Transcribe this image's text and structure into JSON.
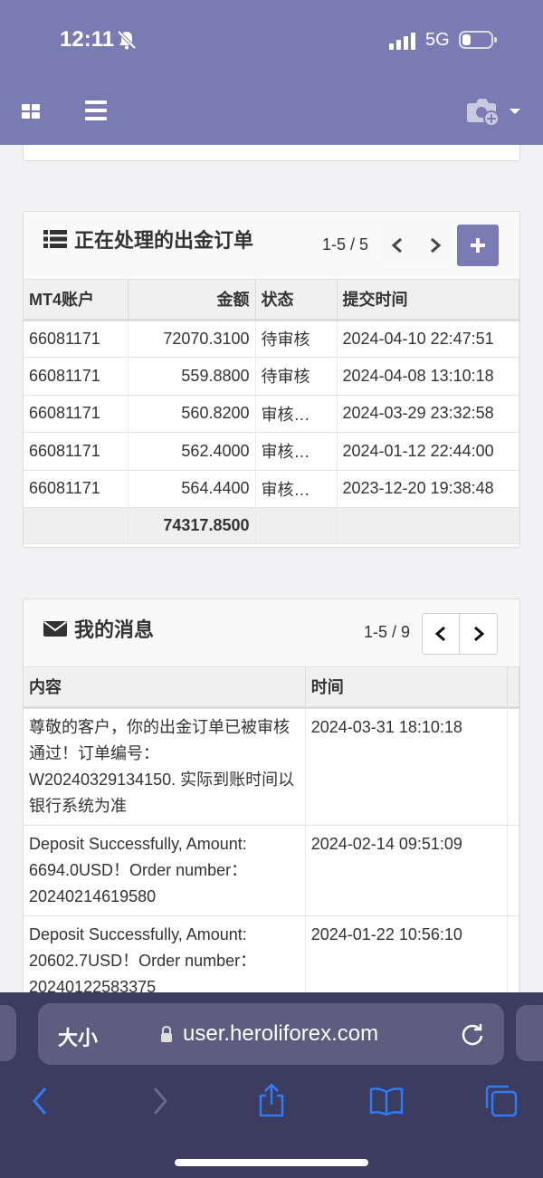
{
  "status_bar": {
    "time": "12:11",
    "network": "5G"
  },
  "orders_panel": {
    "title": "正在处理的出金订单",
    "pager": "1-5 / 5",
    "headers": [
      "MT4账户",
      "金额",
      "状态",
      "提交时间"
    ],
    "rows": [
      {
        "account": "66081171",
        "amount": "72070.3100",
        "status": "待审核",
        "time": "2024-04-10 22:47:51"
      },
      {
        "account": "66081171",
        "amount": "559.8800",
        "status": "待审核",
        "time": "2024-04-08 13:10:18"
      },
      {
        "account": "66081171",
        "amount": "560.8200",
        "status": "审核…",
        "time": "2024-03-29 23:32:58"
      },
      {
        "account": "66081171",
        "amount": "562.4000",
        "status": "审核…",
        "time": "2024-01-12 22:44:00"
      },
      {
        "account": "66081171",
        "amount": "564.4400",
        "status": "审核…",
        "time": "2023-12-20 19:38:48"
      }
    ],
    "total": "74317.8500"
  },
  "messages_panel": {
    "title": "我的消息",
    "pager": "1-5 / 9",
    "headers": [
      "内容",
      "时间"
    ],
    "rows": [
      {
        "content": "尊敬的客户，你的出金订单已被审核通过！订单编号：W20240329134150. 实际到账时间以银行系统为准",
        "time": "2024-03-31 18:10:18"
      },
      {
        "content": "Deposit Successfully, Amount: 6694.0USD！Order number：20240214619580",
        "time": "2024-02-14 09:51:09"
      },
      {
        "content": "Deposit Successfully, Amount: 20602.7USD！Order number：20240122583375",
        "time": "2024-01-22 10:56:10"
      }
    ]
  },
  "browser": {
    "text_size_label": "大小",
    "url": "user.heroliforex.com"
  },
  "colors": {
    "accent": "#7b7bb4",
    "toolbar": "#3c3b60",
    "link_blue": "#2f7cf6"
  },
  "icons": [
    "bell-muted-icon",
    "signal-icon",
    "battery-icon",
    "grid-icon",
    "menu-icon",
    "camera-add-icon",
    "list-icon",
    "envelope-icon",
    "chevron-left-icon",
    "chevron-right-icon",
    "plus-icon",
    "lock-icon",
    "reload-icon",
    "share-icon",
    "bookmarks-icon",
    "tabs-icon"
  ]
}
